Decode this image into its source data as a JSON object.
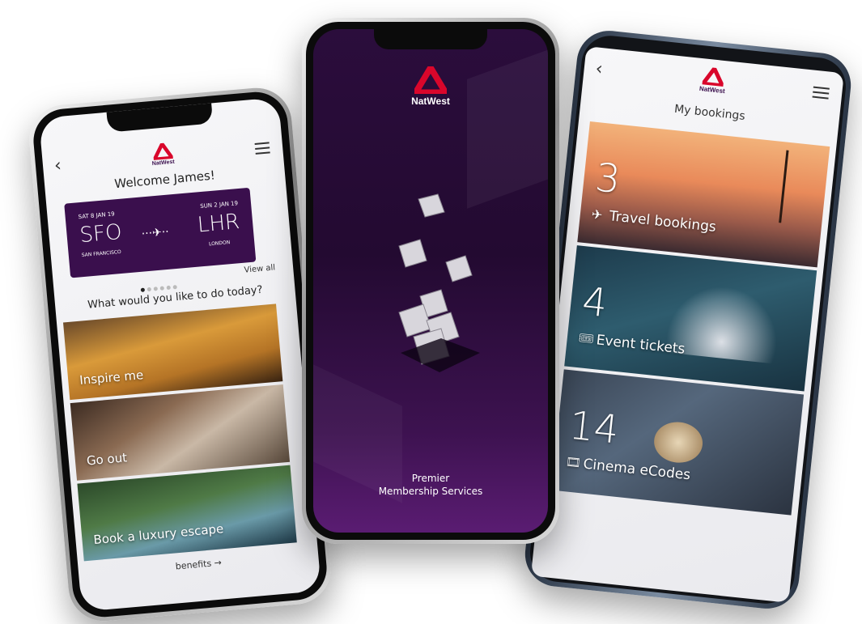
{
  "brand": {
    "name": "NatWest",
    "primary_color": "#d9062b",
    "purple": "#3a0f4d"
  },
  "left_phone": {
    "back_icon": "chevron-left-icon",
    "menu_icon": "hamburger-icon",
    "welcome": "Welcome James!",
    "flight": {
      "depart_date": "SAT 8 JAN 19",
      "depart_code": "SFO",
      "depart_city": "SAN FRANCISCO",
      "arrive_date": "SUN 2 JAN 19",
      "arrive_code": "LHR",
      "arrive_city": "LONDON"
    },
    "carousel": {
      "pages": 6,
      "active": 1
    },
    "view_all": "View all",
    "prompt": "What would you like to do today?",
    "tiles": [
      {
        "label": "Inspire me"
      },
      {
        "label": "Go out"
      },
      {
        "label": "Book a luxury escape"
      }
    ],
    "footer_link": "benefits →"
  },
  "center_phone": {
    "footer_line1": "Premier",
    "footer_line2": "Membership Services"
  },
  "right_phone": {
    "back_icon": "chevron-left-icon",
    "menu_icon": "hamburger-icon",
    "title": "My bookings",
    "bookings": [
      {
        "count": "3",
        "icon": "airplane-icon",
        "label": "Travel bookings"
      },
      {
        "count": "4",
        "icon": "ticket-icon",
        "label": "Event tickets"
      },
      {
        "count": "14",
        "icon": "film-icon",
        "label": "Cinema eCodes"
      }
    ]
  }
}
